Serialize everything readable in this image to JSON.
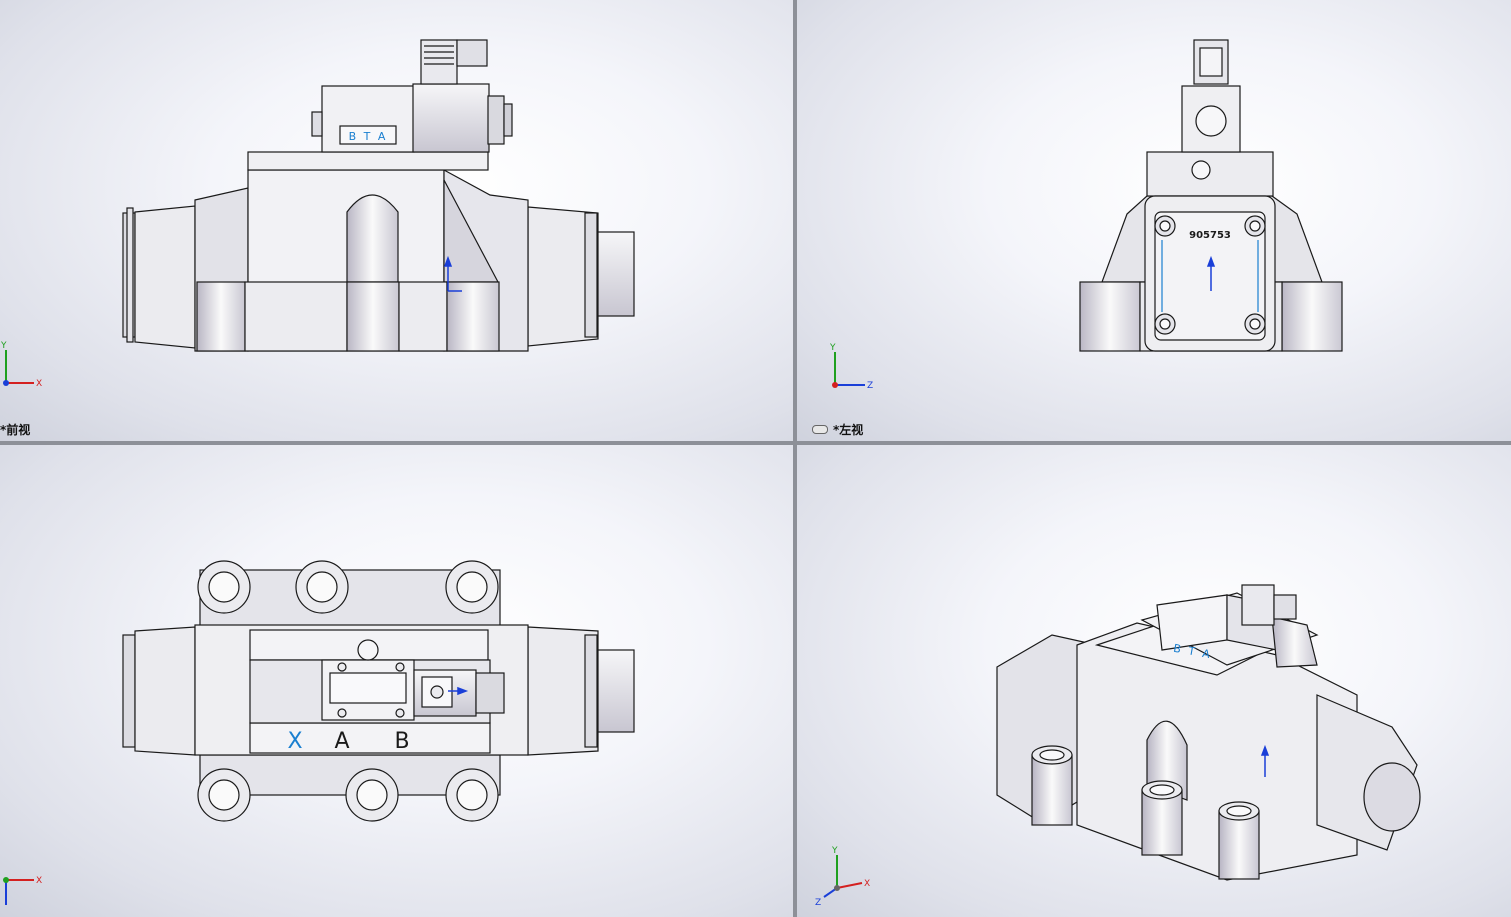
{
  "viewports": {
    "front": {
      "label": "*前视"
    },
    "left": {
      "label": "*左视"
    },
    "top": {
      "label": ""
    },
    "iso": {
      "label": ""
    }
  },
  "part_markings": {
    "brand": "B T A",
    "serial": "905753",
    "port_x": "X",
    "port_a": "A",
    "port_b": "B"
  },
  "triads": {
    "front": {
      "y": "Y",
      "x": "X"
    },
    "left": {
      "y": "Y",
      "z": "Z"
    },
    "top": {
      "x": "X"
    },
    "iso": {
      "y": "Y",
      "x": "X",
      "z": "Z"
    }
  },
  "colors": {
    "background_center": "#ffffff",
    "background_edge": "#cfd2dd",
    "part_fill": "#e9e9ee",
    "part_edge": "#1a1a1a",
    "sketch_blue": "#1a7fd0",
    "axis_x": "#d42020",
    "axis_y": "#1fa01f",
    "axis_z": "#1a3fd8"
  }
}
